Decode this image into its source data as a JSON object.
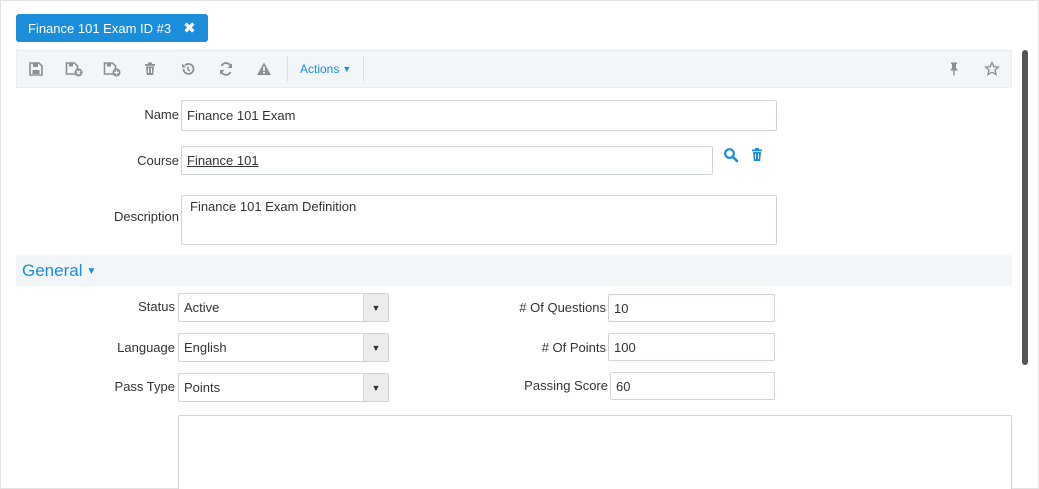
{
  "tab": {
    "title": "Finance 101 Exam ID #3",
    "close_glyph": "✖"
  },
  "toolbar": {
    "icons": [
      "save-icon",
      "save-close-icon",
      "save-new-icon",
      "trash-icon",
      "undo-icon",
      "refresh-icon",
      "warning-icon"
    ],
    "actions_label": "Actions",
    "right_icons": [
      "pin-icon",
      "star-icon"
    ]
  },
  "form": {
    "name_label": "Name",
    "name_value": "Finance 101 Exam",
    "course_label": "Course",
    "course_value": "Finance 101",
    "description_label": "Description",
    "description_value": "Finance 101 Exam Definition"
  },
  "general": {
    "section_title": "General",
    "status_label": "Status",
    "status_value": "Active",
    "language_label": "Language",
    "language_value": "English",
    "pass_type_label": "Pass Type",
    "pass_type_value": "Points",
    "questions_label": "# Of Questions",
    "questions_value": "10",
    "points_label": "# Of Points",
    "points_value": "100",
    "passing_score_label": "Passing Score",
    "passing_score_value": "60"
  },
  "colors": {
    "accent": "#1a8ddb",
    "toolbar_bg": "#f3f6f9",
    "icon_gray": "#8a8f95"
  }
}
